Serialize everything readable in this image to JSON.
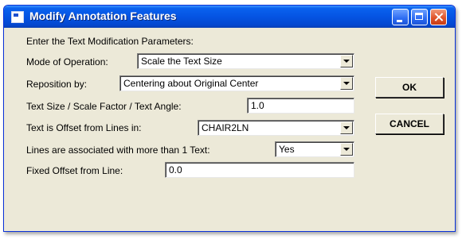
{
  "window": {
    "title": "Modify Annotation Features"
  },
  "form": {
    "heading": "Enter the Text Modification Parameters:",
    "mode_label": "Mode of Operation:",
    "mode_value": "Scale the Text Size",
    "reposition_label": "Reposition by:",
    "reposition_value": "Centering about Original Center",
    "size_label": "Text Size / Scale Factor / Text Angle:",
    "size_value": "1.0",
    "offset_lines_label": "Text is Offset from Lines in:",
    "offset_lines_value": "CHAIR2LN",
    "multi_text_label": "Lines are associated with more than 1 Text:",
    "multi_text_value": "Yes",
    "fixed_offset_label": "Fixed Offset from Line:",
    "fixed_offset_value": "0.0"
  },
  "buttons": {
    "ok": "OK",
    "cancel": "CANCEL"
  },
  "icons": {
    "app": "window-app-icon",
    "minimize": "minimize-icon",
    "maximize": "maximize-icon",
    "close": "close-icon",
    "dropdown": "chevron-down-icon"
  }
}
